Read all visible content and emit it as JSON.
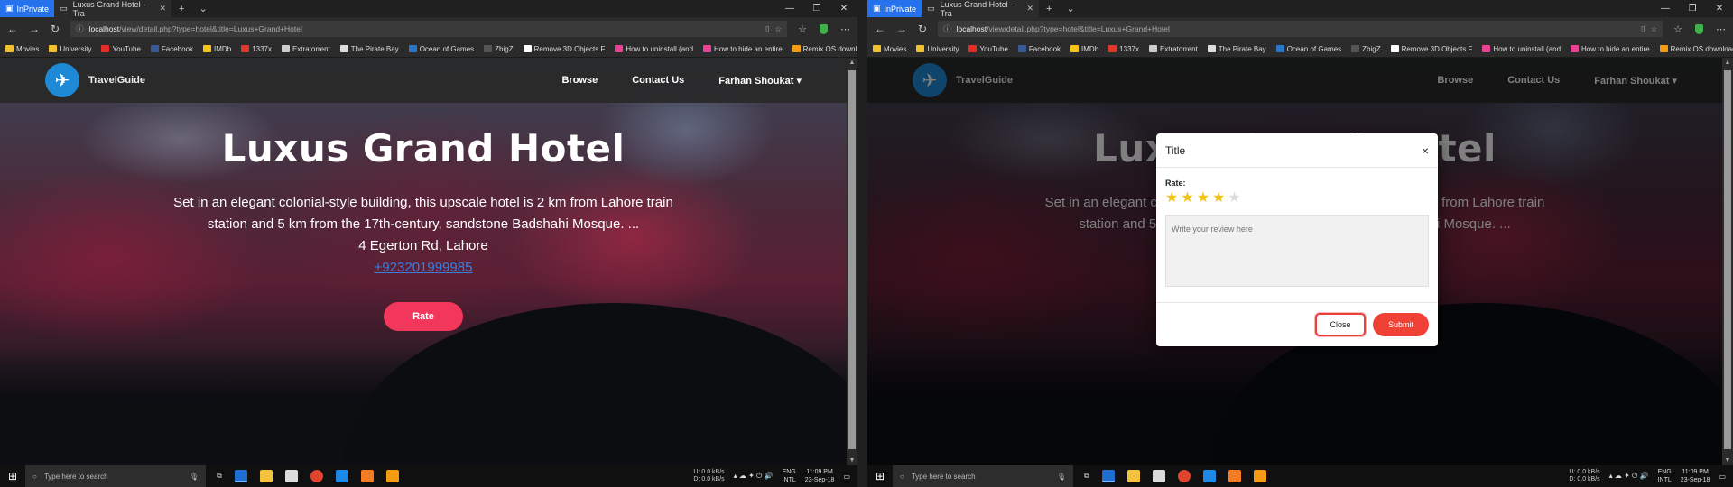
{
  "browser": {
    "inprivate_label": "InPrivate",
    "tab_title": "Luxus Grand Hotel - Tra",
    "address_host": "localhost",
    "address_path": "/view/detail.php?type=hotel&title=Luxus+Grand+Hotel",
    "favorites": [
      {
        "label": "Movies",
        "color": "#f2c12e"
      },
      {
        "label": "University",
        "color": "#f2c12e"
      },
      {
        "label": "YouTube",
        "color": "#e52d27"
      },
      {
        "label": "Facebook",
        "color": "#3b5998"
      },
      {
        "label": "IMDb",
        "color": "#f5c518"
      },
      {
        "label": "1337x",
        "color": "#e0382b"
      },
      {
        "label": "Extratorrent",
        "color": "#cccccc"
      },
      {
        "label": "The Pirate Bay",
        "color": "#dddddd"
      },
      {
        "label": "Ocean of Games",
        "color": "#2b76c8"
      },
      {
        "label": "ZbigZ",
        "color": "#555555"
      },
      {
        "label": "Remove 3D Objects F",
        "color": "#ffffff"
      },
      {
        "label": "How to uninstall (and",
        "color": "#e84393"
      },
      {
        "label": "How to hide an entire",
        "color": "#e84393"
      },
      {
        "label": "Remix OS download |",
        "color": "#f39c12"
      }
    ]
  },
  "site": {
    "brand": "TravelGuide",
    "nav": [
      "Browse",
      "Contact Us",
      "Farhan Shoukat ▾"
    ]
  },
  "hotel": {
    "name": "Luxus Grand Hotel",
    "description": "Set in an elegant colonial-style building, this upscale hotel is 2 km from Lahore train station and 5 km from the 17th-century, sandstone Badshahi Mosque. ...",
    "address": "4 Egerton Rd, Lahore",
    "phone": "+923201999985",
    "rate_button": "Rate"
  },
  "modal": {
    "title": "Title",
    "close_x": "×",
    "rate_label": "Rate:",
    "rating": 4,
    "max_rating": 5,
    "review_placeholder": "Write your review here",
    "close_button": "Close",
    "submit_button": "Submit"
  },
  "taskbar": {
    "search_placeholder": "Type here to search",
    "net_up": "U:",
    "net_down": "D:",
    "net_up_speed": "0.0 kB/s",
    "net_down_speed": "0.0 kB/s",
    "lang": "ENG",
    "layout": "INTL",
    "time": "11:09 PM",
    "date": "23-Sep-18"
  }
}
